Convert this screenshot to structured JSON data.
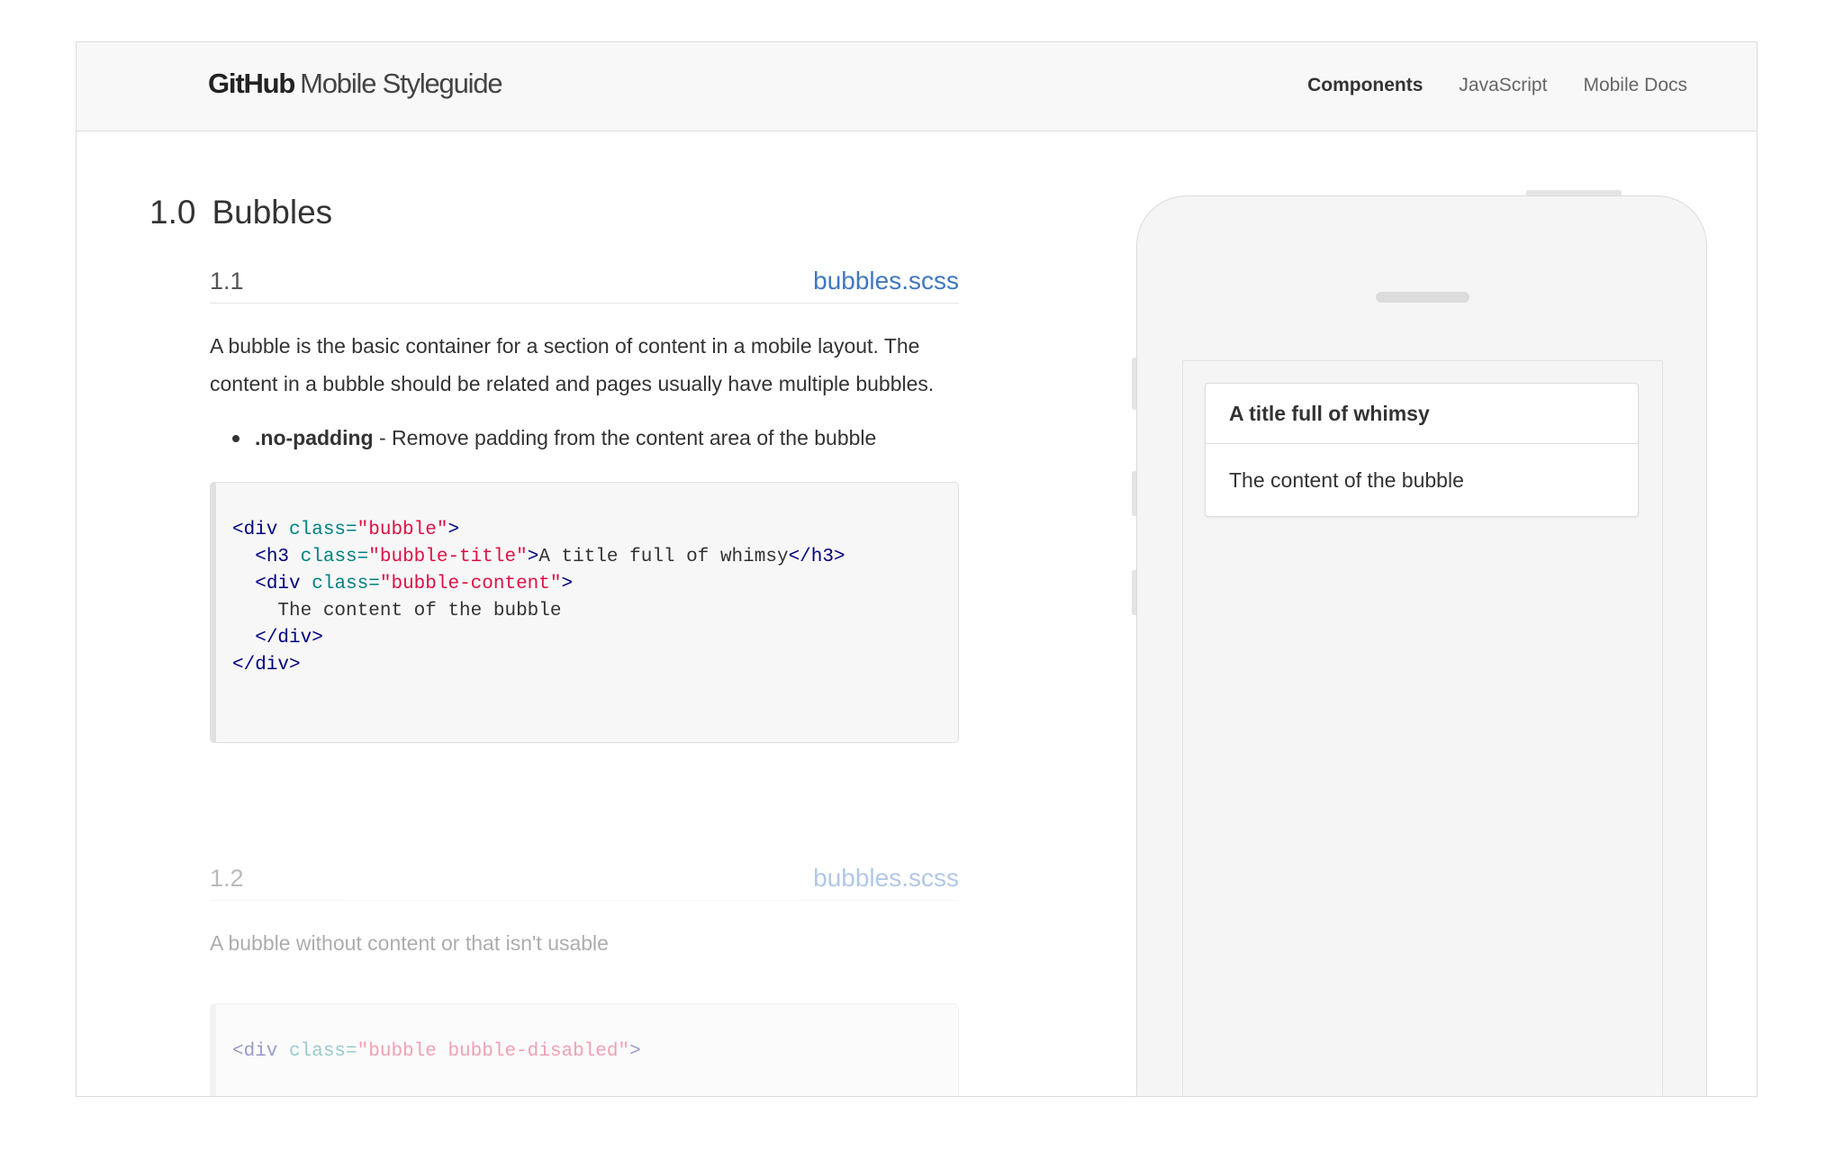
{
  "header": {
    "logo_mark": "GitHub",
    "logo_sub": "Mobile Styleguide",
    "nav": [
      {
        "label": "Components",
        "active": true
      },
      {
        "label": "JavaScript",
        "active": false
      },
      {
        "label": "Mobile Docs",
        "active": false
      }
    ]
  },
  "section": {
    "number": "1.0",
    "title": "Bubbles"
  },
  "examples": [
    {
      "number": "1.1",
      "file": "bubbles.scss",
      "description": "A bubble is the basic container for a section of content in a mobile layout. The content in a bubble should be related and pages usually have multiple bubbles.",
      "modifiers": [
        {
          "name": ".no-padding",
          "text": " - Remove padding from the content area of the bubble"
        }
      ],
      "code": {
        "l1_open": "<div ",
        "l1_attr": "class=",
        "l1_str": "\"bubble\"",
        "l1_close": ">",
        "l2_open": "<h3 ",
        "l2_attr": "class=",
        "l2_str": "\"bubble-title\"",
        "l2_mid": ">",
        "l2_text": "A title full of whimsy",
        "l2_close": "</h3>",
        "l3_open": "<div ",
        "l3_attr": "class=",
        "l3_str": "\"bubble-content\"",
        "l3_close": ">",
        "l4_text": "The content of the bubble",
        "l5_close": "</div>",
        "l6_close": "</div>"
      }
    },
    {
      "number": "1.2",
      "file": "bubbles.scss",
      "description": "A bubble without content or that isn't usable",
      "code": {
        "l1_open": "<div ",
        "l1_attr": "class=",
        "l1_str": "\"bubble bubble-disabled\"",
        "l1_close": ">"
      }
    }
  ],
  "preview": {
    "bubble_title": "A title full of whimsy",
    "bubble_content": "The content of the bubble"
  }
}
